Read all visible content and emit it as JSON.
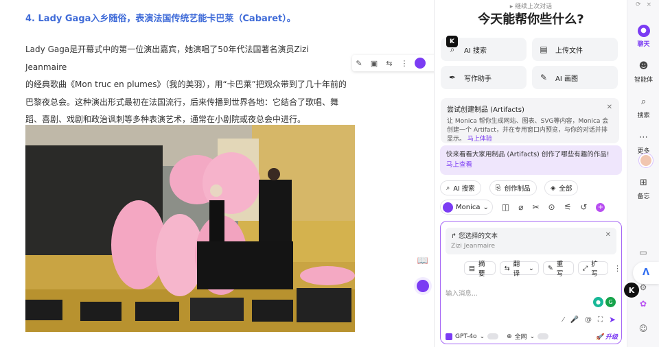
{
  "article": {
    "heading": "4. Lady Gaga入乡随俗，表演法国传统艺能卡巴莱（Cabaret）。",
    "paragraph_lines": [
      "Lady Gaga是开幕式中的第一位演出嘉宾，她演唱了50年代法国著名演员Zizi Jeanmaire",
      "的经典歌曲《Mon truc en plumes》（我的美羽），用“卡巴莱”把观众带到了几十年前的",
      "巴黎夜总会。这种演出形式最初在法国流行，后来传播到世界各地：它结合了歌唱、舞",
      "蹈、喜剧、戏剧和政治讽刺等多种表演艺术，通常在小剧院或夜总会中进行。"
    ]
  },
  "selection_toolbar": {
    "icons": [
      "highlighter-icon",
      "note-icon",
      "translate-icon",
      "more-icon",
      "monica-icon"
    ],
    "glyphs": [
      "✎",
      "▣",
      "⇆",
      "⋮",
      "●"
    ]
  },
  "side_float": {
    "icons": [
      "book-icon",
      "monica-float-icon"
    ],
    "glyphs": [
      "📖",
      ""
    ]
  },
  "panel": {
    "continue_label": "▸ 继续上次对话",
    "welcome_title": "今天能帮你些什么?",
    "k_badge": "K",
    "tiles": [
      {
        "label": "AI 搜索",
        "icon": "search-icon",
        "glyph": "⌕"
      },
      {
        "label": "上传文件",
        "icon": "file-icon",
        "glyph": "▤"
      },
      {
        "label": "写作助手",
        "icon": "pen-icon",
        "glyph": "✒"
      },
      {
        "label": "AI 画图",
        "icon": "brush-icon",
        "glyph": "✎"
      }
    ],
    "artifact_card": {
      "title": "尝试创建制品 (Artifacts)",
      "desc": "让 Monica 帮你生成网站、图表、SVG等内容，Monica 会创建一个 Artifact，并在专用窗口内预览，与你的对话并排显示。",
      "link": "马上体验"
    },
    "promo": {
      "text": "快来看看大家用制品 (Artifacts) 创作了哪些有趣的作品!",
      "link": "马上查看"
    },
    "chips": [
      {
        "label": "AI 搜索",
        "glyph": "⌕"
      },
      {
        "label": "创作制品",
        "glyph": "⎘"
      },
      {
        "label": "全部",
        "glyph": "◈"
      }
    ],
    "model_row": {
      "model": "Monica",
      "icons": [
        "book-icon",
        "paperclip-icon",
        "scissors-icon",
        "pin-icon",
        "sliders-icon",
        "history-icon",
        "new-chat-icon"
      ],
      "glyphs": [
        "◫",
        "⌀",
        "✂",
        "⊙",
        "⚟",
        "↺",
        "+"
      ]
    },
    "composer": {
      "quote_header": "↱ 您选择的文本",
      "quote_text": "Zizi Jeanmaire",
      "quick_actions": [
        {
          "label": "摘要",
          "glyph": "▤"
        },
        {
          "label": "翻译",
          "glyph": "⇆"
        },
        {
          "label": "重写",
          "glyph": "✎"
        },
        {
          "label": "扩写",
          "glyph": "⤢"
        }
      ],
      "placeholder": "输入消息...",
      "tool_glyphs": [
        "⁄",
        "🎤",
        "@",
        "⛶",
        "➤"
      ],
      "model": "GPT-4o",
      "web": "全网",
      "upgrade": "升级"
    }
  },
  "rail": {
    "top_glyphs": [
      "⟳",
      "×"
    ],
    "items": [
      {
        "label": "聊天",
        "glyph": "●",
        "active": true
      },
      {
        "label": "智能体",
        "glyph": "☻",
        "active": false
      },
      {
        "label": "搜索",
        "glyph": "⌕",
        "active": false
      },
      {
        "label": "更多",
        "glyph": "⋯",
        "active": false
      },
      {
        "label": "备忘",
        "glyph": "⊞",
        "active": false
      }
    ],
    "lower_glyphs": [
      "▭",
      "⚙",
      "☺"
    ],
    "ai_logo": "Λ",
    "k_badge": "K"
  },
  "colors": {
    "accent": "#7b3cf3",
    "heading": "#3f6bd8",
    "promo_bg": "#efe6fc"
  }
}
